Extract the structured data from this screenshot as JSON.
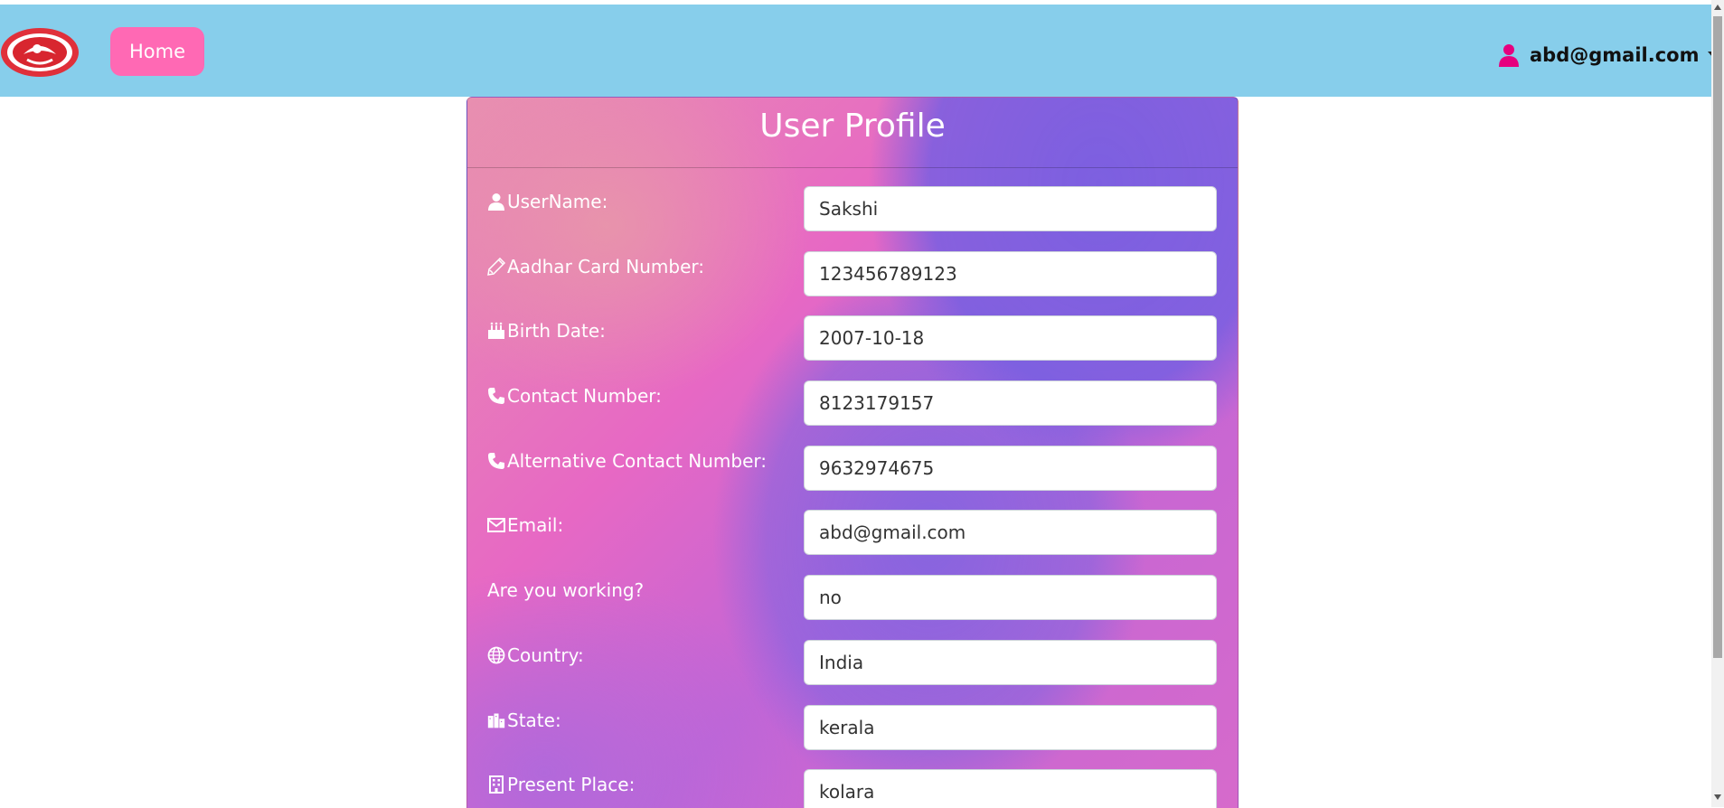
{
  "navbar": {
    "home_label": "Home",
    "user_email": "abd@gmail.com",
    "bg_color": "#87CEEB",
    "home_color": "#ff69b4"
  },
  "profile": {
    "title": "User Profile",
    "fields": [
      {
        "label": "UserName:",
        "icon": "user-icon",
        "value": "Sakshi"
      },
      {
        "label": "Aadhar Card Number:",
        "icon": "pencil-icon",
        "value": "123456789123"
      },
      {
        "label": "Birth Date:",
        "icon": "birthday-cake-icon",
        "value": "2007-10-18"
      },
      {
        "label": "Contact Number:",
        "icon": "phone-icon",
        "value": "8123179157"
      },
      {
        "label": "Alternative Contact Number:",
        "icon": "phone-icon",
        "value": "9632974675"
      },
      {
        "label": "Email:",
        "icon": "envelope-icon",
        "value": "abd@gmail.com"
      },
      {
        "label": "Are you working?",
        "icon": "",
        "value": "no"
      },
      {
        "label": "Country:",
        "icon": "globe-icon",
        "value": "India"
      },
      {
        "label": "State:",
        "icon": "city-icon",
        "value": "kerala"
      },
      {
        "label": "Present Place:",
        "icon": "building-icon",
        "value": "kolara"
      }
    ]
  }
}
